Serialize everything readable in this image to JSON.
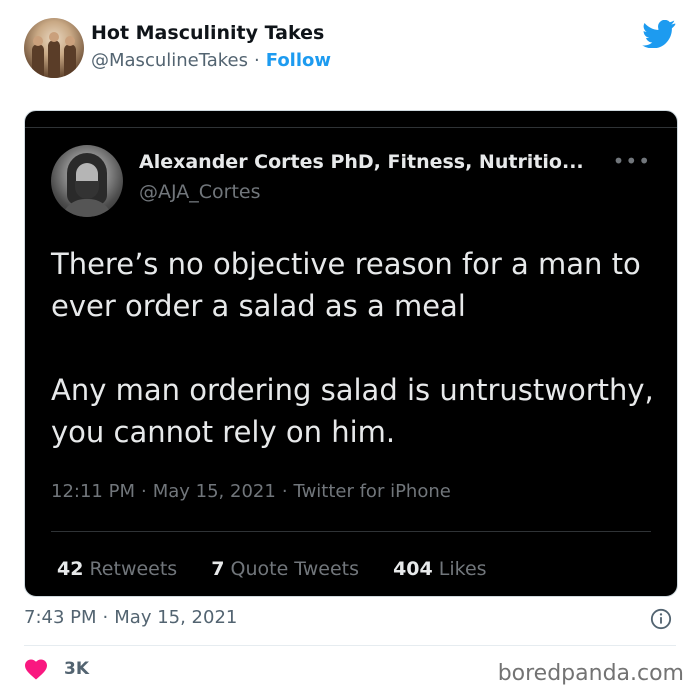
{
  "header": {
    "account_name": "Hot Masculinity Takes",
    "handle": "@MasculineTakes",
    "separator": "·",
    "follow_label": "Follow"
  },
  "embedded_tweet": {
    "author_name": "Alexander Cortes PhD, Fitness, Nutritio...",
    "author_handle": "@AJA_Cortes",
    "more_label": "•••",
    "text": "There’s no objective reason for a man to ever order a salad as a meal\n\nAny man ordering salad is untrustworthy, you cannot rely on him.",
    "time": "12:11 PM",
    "date": "May 15, 2021",
    "source": "Twitter for iPhone",
    "retweets_count": "42",
    "retweets_label": "Retweets",
    "quote_count": "7",
    "quote_label": "Quote Tweets",
    "likes_count": "404",
    "likes_label": "Likes"
  },
  "footer": {
    "time": "7:43 PM",
    "date": "May 15, 2021",
    "likes": "3K",
    "watermark": "boredpanda.com"
  },
  "colors": {
    "twitter_blue": "#1d9bf0",
    "heart_red": "#f91880",
    "embed_background": "#000000"
  },
  "icons": [
    "twitter-bird-icon",
    "info-icon",
    "heart-icon",
    "more-options-icon"
  ]
}
